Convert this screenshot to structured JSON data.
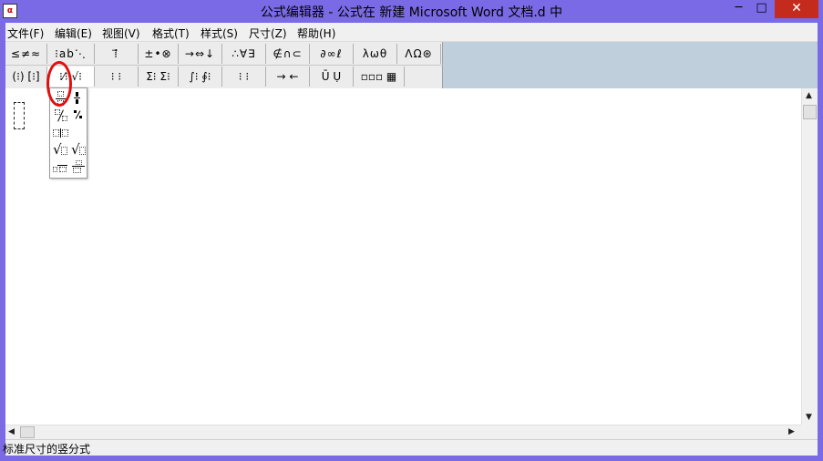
{
  "window": {
    "title": "公式编辑器 - 公式在 新建 Microsoft Word 文档.d 中",
    "min_label": "─",
    "max_label": "□",
    "close_label": "✕",
    "icon_glyph": "α"
  },
  "menu": {
    "items": [
      "文件(F)",
      "编辑(E)",
      "视图(V)",
      "格式(T)",
      "样式(S)",
      "尺寸(Z)",
      "帮助(H)"
    ]
  },
  "palette": {
    "row1": [
      "≤≠≈",
      "⁝ab⋱",
      "⁞⃗⃗⃗",
      "±•⊗",
      "→⇔↓",
      "∴∀∃",
      "∉∩⊂",
      "∂∞ℓ",
      "λωθ",
      "ΛΩ⊛"
    ],
    "row2": [
      "(⁝) [⁝]",
      "⁝⁄⁝ √⁝",
      "⁝ ⁝",
      "Σ⁝ Σ⁝",
      "∫⁝ ∮⁝",
      "⁝ ⁝",
      "→ ←",
      "Ū Ụ",
      "▫▫▫ ▦"
    ]
  },
  "dropdown": {
    "name": "fraction-and-radical-templates",
    "items": [
      "full-size-vertical-fraction",
      "small-vertical-fraction",
      "full-size-slash-fraction",
      "small-slash-fraction",
      "horizontal-fraction",
      "square-root",
      "nth-root",
      "long-division",
      "long-division-reverse"
    ],
    "highlight_color": "#e01010"
  },
  "status": {
    "text": "标准尺寸的竖分式"
  },
  "colors": {
    "title_bar": "#7a6ae6",
    "close_button": "#c42b1c",
    "toolbar_bg": "#c0cfdc"
  }
}
